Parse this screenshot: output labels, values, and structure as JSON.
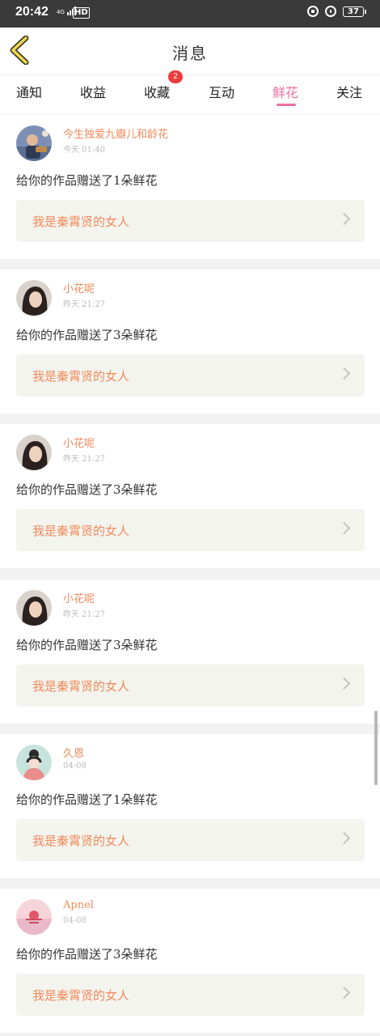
{
  "status_bar": {
    "time": "20:42",
    "network": "4G",
    "hd": "HD",
    "battery": "37"
  },
  "header": {
    "title": "消息",
    "back_icon": "back-arrow-icon"
  },
  "tabs": [
    {
      "label": "通知"
    },
    {
      "label": "收益"
    },
    {
      "label": "收藏",
      "badge": "2"
    },
    {
      "label": "互动"
    },
    {
      "label": "鲜花",
      "active": true
    },
    {
      "label": "关注"
    }
  ],
  "messages": [
    {
      "username": "今生独爱九瓣儿和龄花",
      "time": "今天 01:40",
      "content": "给你的作品赠送了1朵鲜花",
      "work_title": "我是秦霄贤的女人"
    },
    {
      "username": "小花呢",
      "time": "昨天 21:27",
      "content": "给你的作品赠送了3朵鲜花",
      "work_title": "我是秦霄贤的女人"
    },
    {
      "username": "小花呢",
      "time": "昨天 21:27",
      "content": "给你的作品赠送了3朵鲜花",
      "work_title": "我是秦霄贤的女人"
    },
    {
      "username": "小花呢",
      "time": "昨天 21:27",
      "content": "给你的作品赠送了3朵鲜花",
      "work_title": "我是秦霄贤的女人"
    },
    {
      "username": "久恩",
      "time": "04-08",
      "content": "给你的作品赠送了1朵鲜花",
      "work_title": "我是秦霄贤的女人"
    },
    {
      "username": "Apnel",
      "time": "04-08",
      "content": "给你的作品赠送了3朵鲜花",
      "work_title": "我是秦霄贤的女人"
    }
  ],
  "colors": {
    "accent_pink": "#ec6fa0",
    "name_orange": "#f08a5c",
    "badge_red": "#ee3b3b"
  }
}
